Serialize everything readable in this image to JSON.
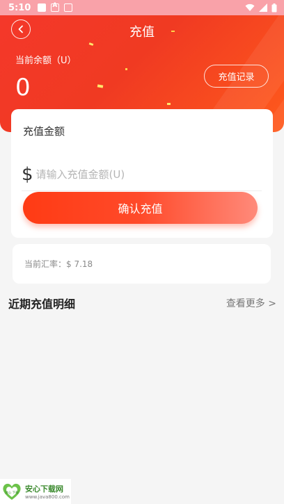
{
  "status_bar": {
    "time": "5:10",
    "icons": [
      "notification-square-icon",
      "a-notification-icon",
      "image-notification-icon",
      "wifi-icon",
      "signal-icon",
      "battery-icon"
    ]
  },
  "header": {
    "title": "充值",
    "balance_label": "当前余额（U）",
    "balance_value": "0",
    "record_button": "充值记录",
    "back_icon": "chevron-left-icon"
  },
  "recharge": {
    "amount_label": "充值金额",
    "currency_symbol": "$",
    "placeholder": "请输入充值金额(U)",
    "value": "",
    "confirm_button": "确认充值"
  },
  "rate": {
    "text": "当前汇率：$ 7.18"
  },
  "recent": {
    "title": "近期充值明细",
    "more": "查看更多 >"
  },
  "watermark": {
    "badge_text": "放心 下载",
    "title": "安心下载网",
    "url": "www.java800.com"
  },
  "colors": {
    "header_gradient_start": "#f4382a",
    "header_gradient_end": "#ff5a1c",
    "button_gradient_start": "#ff3b14",
    "button_gradient_end": "#ff8a7a",
    "status_bar": "#f9a2a9",
    "background": "#f5f5f5"
  }
}
